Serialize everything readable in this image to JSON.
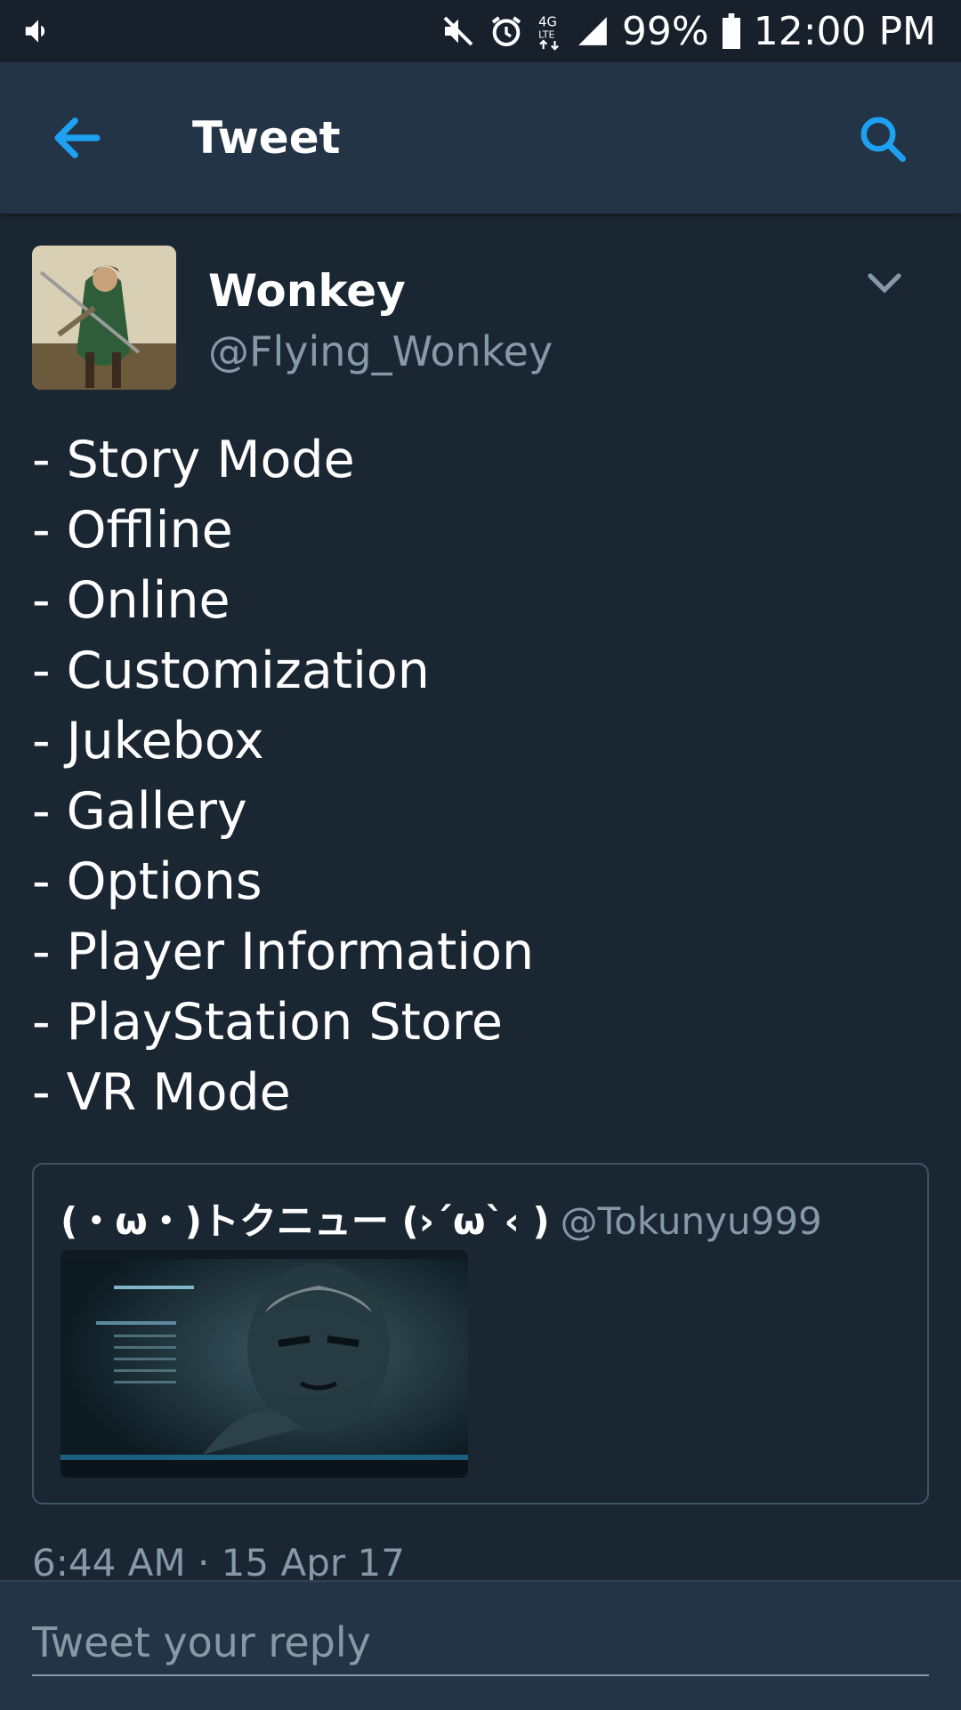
{
  "status_bar": {
    "battery": "99%",
    "time": "12:00 PM",
    "icons": [
      "volume-icon",
      "mute-icon",
      "alarm-icon",
      "4g-lte-icon",
      "signal-icon",
      "battery-icon"
    ]
  },
  "app_bar": {
    "title": "Tweet",
    "accent_color": "#1da1f2"
  },
  "tweet": {
    "author": {
      "name": "Wonkey",
      "handle": "@Flying_Wonkey"
    },
    "lines": [
      "- Story Mode",
      "- Offline",
      "- Online",
      "- Customization",
      "- Jukebox",
      "- Gallery",
      "- Options",
      "- Player Information",
      "- PlayStation Store",
      "- VR Mode"
    ],
    "quoted": {
      "name": "(・ω・)トクニュー (›´ω`‹ )",
      "handle": "@Tokunyu999"
    },
    "timestamp": "6:44 AM · 15 Apr 17"
  },
  "reply": {
    "placeholder": "Tweet your reply"
  },
  "colors": {
    "background": "#1b2633",
    "app_bar": "#243447",
    "secondary_text": "#8899a6"
  }
}
